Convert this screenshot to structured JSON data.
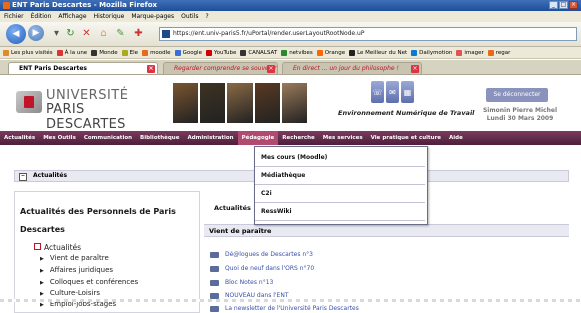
{
  "window": {
    "title": "ENT Paris Descartes - Mozilla Firefox",
    "controls": [
      "_",
      "□",
      "×"
    ]
  },
  "menubar": {
    "items": [
      "Fichier",
      "Édition",
      "Affichage",
      "Historique",
      "Marque-pages",
      "Outils",
      "?"
    ]
  },
  "navbar": {
    "url": "https://ent.univ-paris5.fr/uPortal/render.userLayoutRootNode.uP"
  },
  "bookmarks": [
    {
      "label": "Les plus visités",
      "color": "#e08a2a"
    },
    {
      "label": "À la une",
      "color": "#d33"
    },
    {
      "label": "Monde",
      "color": "#333"
    },
    {
      "label": "Ele",
      "color": "#aa2"
    },
    {
      "label": "moodle",
      "color": "#e96a1c"
    },
    {
      "label": "Google",
      "color": "#3a6fd8"
    },
    {
      "label": "YouTube",
      "color": "#c00"
    },
    {
      "label": "CANALSAT",
      "color": "#333"
    },
    {
      "label": "netvibes",
      "color": "#2a8a2a"
    },
    {
      "label": "Orange",
      "color": "#f60"
    },
    {
      "label": "Le Meilleur du Net",
      "color": "#222"
    },
    {
      "label": "Dailymotion",
      "color": "#0a7bd1"
    },
    {
      "label": "imager",
      "color": "#d55"
    },
    {
      "label": "regar",
      "color": "#e96a1c"
    }
  ],
  "tabs": {
    "active": "ENT Paris Descartes",
    "inactive1": "Regarder comprendre se souvenir",
    "inactive2": "En direct ... un jour du philosophe !"
  },
  "header": {
    "logo_line1": "UNIVERSITÉ",
    "logo_line2": "PARIS DESCARTES",
    "ent_text": "Environnement Numérique de Travail",
    "logout": "Se déconnecter",
    "user_name": "Simonin Pierre Michel",
    "user_date": "Lundi 30 Mars 2009",
    "photo_colors": [
      "#7a5530",
      "#3d3322",
      "#8a6a45",
      "#5a3a22",
      "#9a7a5a"
    ]
  },
  "mainnav": {
    "items": [
      "Actualités",
      "Mes Outils",
      "Communication",
      "Bibliothèque",
      "Administration",
      "Pédagogie",
      "Recherche",
      "Mes services",
      "Vie pratique et culture",
      "Aide"
    ],
    "active_index": 5
  },
  "dropdown": {
    "items": [
      "Mes cours (Moodle)",
      "Médiathèque",
      "C2i",
      "RessWiki"
    ]
  },
  "content": {
    "panel_title": "Actualités",
    "left_title_line1": "Actualités des Personnels de Paris",
    "left_title_line2": "Descartes",
    "category": "Actualités",
    "subitems": [
      "Vient de paraître",
      "Affaires juridiques",
      "Colloques et conférences",
      "Culture-Loisirs",
      "Emploi-jobs-stages"
    ],
    "right_header": "Actualités",
    "section": "Vient de paraître",
    "news": [
      "Dé@logues de Descartes n°3",
      "Quoi de neuf dans l'ORS n°70",
      "Bloc Notes n°13",
      "NOUVEAU dans l'ENT",
      "La newsletter de l'Université Paris Descartes"
    ]
  }
}
